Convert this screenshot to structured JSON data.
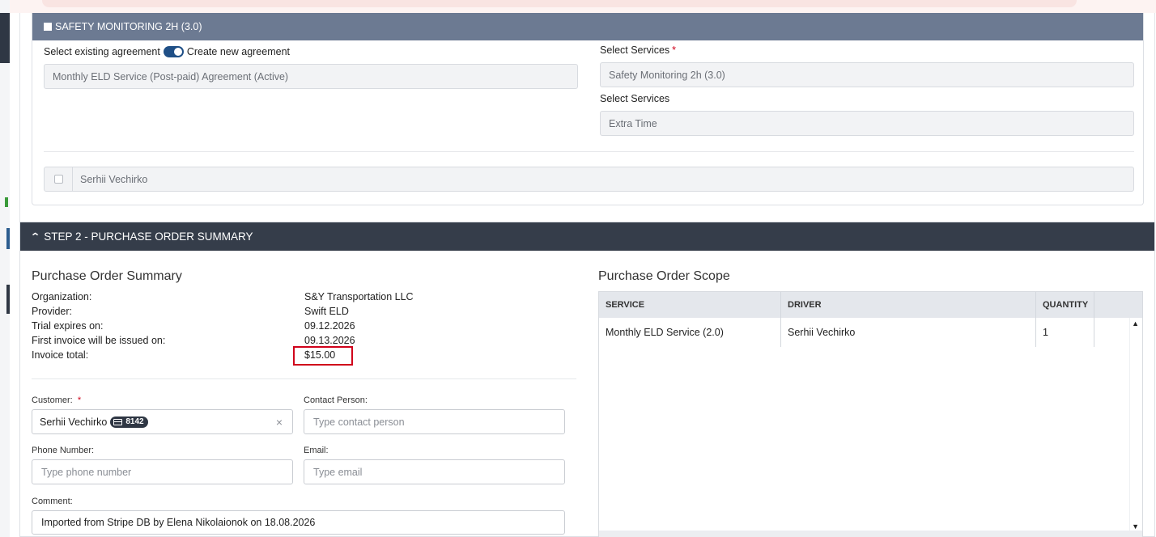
{
  "agreement": {
    "header": "SAFETY MONITORING 2H (3.0)",
    "select_existing_label": "Select existing agreement",
    "create_new_label": "Create new agreement",
    "agreement_value": "Monthly ELD Service (Post-paid) Agreement (Active)",
    "select_services_label_1": "Select Services",
    "required_mark": "*",
    "service_value_1": "Safety Monitoring 2h (3.0)",
    "select_services_label_2": "Select Services",
    "service_value_2": "Extra Time",
    "driver_name": "Serhii Vechirko"
  },
  "step2": {
    "header": "STEP 2 - PURCHASE ORDER SUMMARY",
    "summary_title": "Purchase Order Summary",
    "summary": [
      {
        "key": "Organization:",
        "value": "S&Y Transportation LLC"
      },
      {
        "key": "Provider:",
        "value": "Swift ELD"
      },
      {
        "key": "Trial expires on:",
        "value": "09.12.2026"
      },
      {
        "key": "First invoice will be issued on:",
        "value": "09.13.2026"
      },
      {
        "key": "Invoice total:",
        "value": "$15.00"
      }
    ],
    "customer_label": "Customer:",
    "customer_required": "*",
    "customer_value": "Serhii Vechirko",
    "customer_badge": "8142",
    "clear_symbol": "×",
    "contact_label": "Contact Person:",
    "contact_placeholder": "Type contact person",
    "phone_label": "Phone Number:",
    "phone_placeholder": "Type phone number",
    "email_label": "Email:",
    "email_placeholder": "Type email",
    "comment_label": "Comment:",
    "comment_value": "Imported from Stripe DB by Elena Nikolaionok on 18.08.2026",
    "scope_title": "Purchase Order Scope",
    "scope_columns": [
      "SERVICE",
      "DRIVER",
      "QUANTITY"
    ],
    "scope_rows": [
      {
        "service": "Monthly ELD Service (2.0)",
        "driver": "Serhii Vechirko",
        "quantity": "1"
      }
    ]
  },
  "colors": {
    "agreement_header": "#6c7a92",
    "step_header": "#353d4a",
    "highlight": "#d0021b",
    "toggle": "#1f4f86"
  }
}
